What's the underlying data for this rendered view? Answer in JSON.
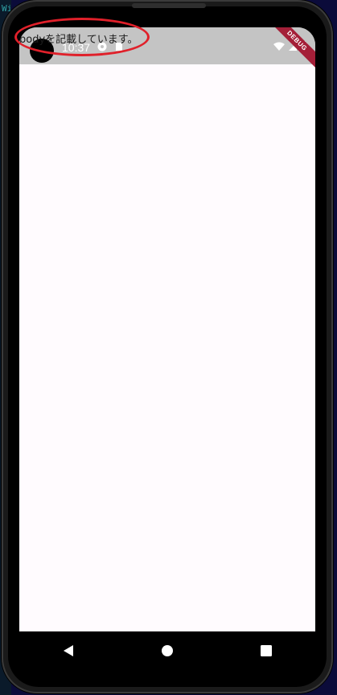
{
  "status_bar": {
    "time": "10:37",
    "debug_banner": "DEBUG"
  },
  "body": {
    "text": "bodyを記載しています。"
  },
  "background": {
    "glyph": "Wi"
  },
  "colors": {
    "status_bar": "#c4c4c4",
    "screen": "#fffbfe",
    "annotation": "#e0202a",
    "debug_ribbon": "#a41f38"
  },
  "nav": {
    "buttons": [
      "back-icon",
      "home-icon",
      "recents-icon"
    ]
  }
}
